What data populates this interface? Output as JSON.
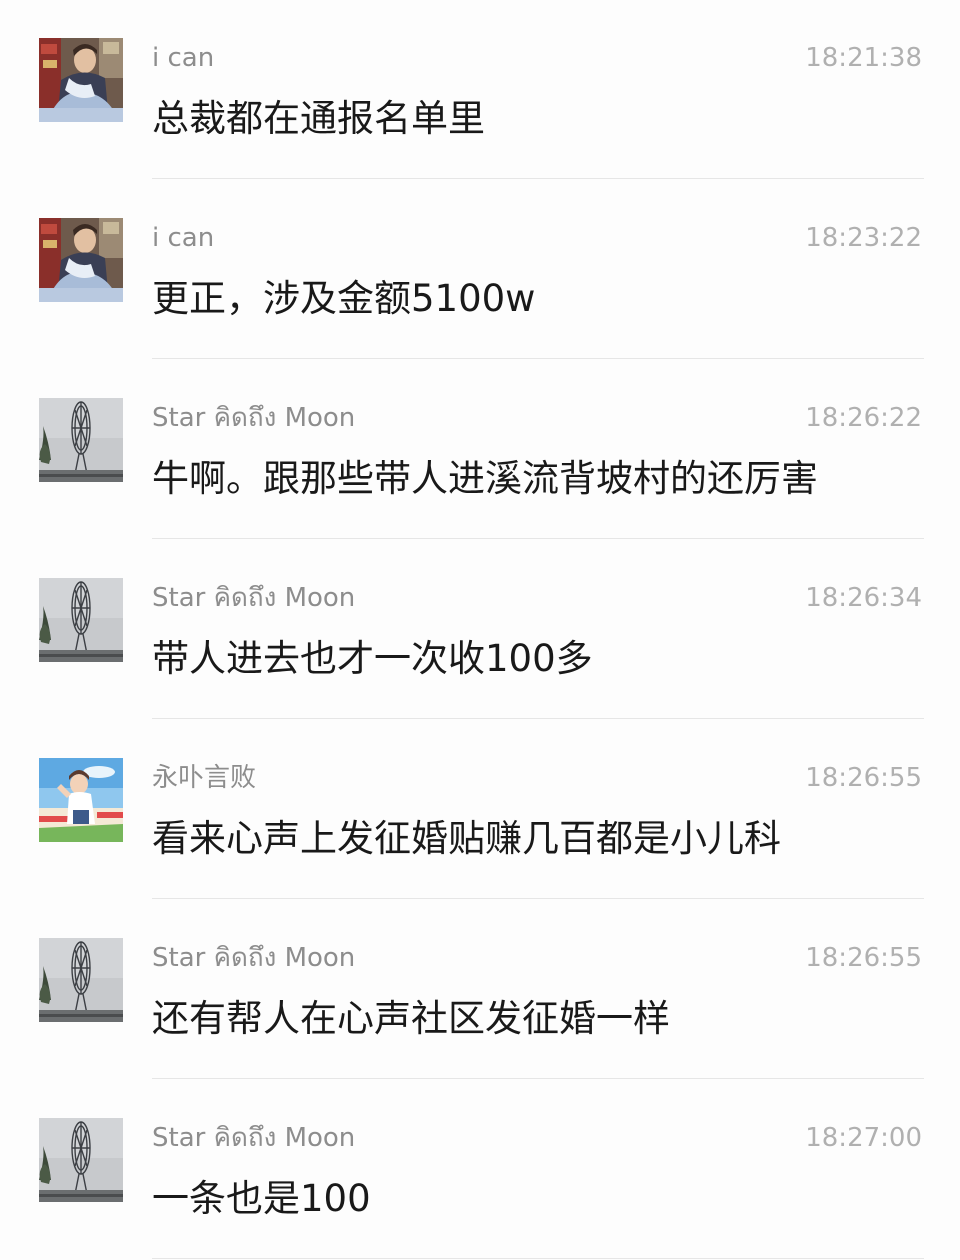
{
  "messages": [
    {
      "sender": "i can",
      "time": "18:21:38",
      "text": "总裁都在通报名单里",
      "avatar": "man-reclining-photo"
    },
    {
      "sender": "i can",
      "time": "18:23:22",
      "text": "更正，涉及金额5100w",
      "avatar": "man-reclining-photo"
    },
    {
      "sender": "Star คิดถึง Moon",
      "time": "18:26:22",
      "text": "牛啊。跟那些带人进溪流背坡村的还厉害",
      "avatar": "ferris-wheel-photo"
    },
    {
      "sender": "Star คิดถึง Moon",
      "time": "18:26:34",
      "text": "带人进去也才一次收100多",
      "avatar": "ferris-wheel-photo"
    },
    {
      "sender": "永卟言败",
      "time": "18:26:55",
      "text": "看来心声上发征婚贴赚几百都是小儿科",
      "avatar": "anime-character-image"
    },
    {
      "sender": "Star คิดถึง Moon",
      "time": "18:26:55",
      "text": "还有帮人在心声社区发征婚一样",
      "avatar": "ferris-wheel-photo"
    },
    {
      "sender": "Star คิดถึง Moon",
      "time": "18:27:00",
      "text": "一条也是100",
      "avatar": "ferris-wheel-photo"
    }
  ]
}
